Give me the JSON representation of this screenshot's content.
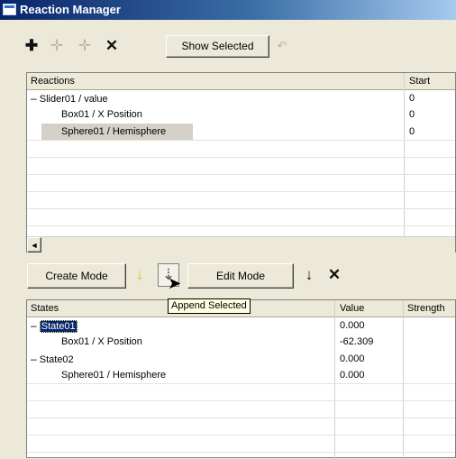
{
  "window": {
    "title": "Reaction Manager"
  },
  "toolbar_top": {
    "icons": [
      "plus-icon",
      "add-slave-icon",
      "add-selected-icon",
      "delete-icon",
      "undo-icon"
    ],
    "show_selected_label": "Show Selected"
  },
  "reactions": {
    "columns": [
      "Reactions",
      "Start"
    ],
    "rows": [
      {
        "expander": "–",
        "name": "Slider01 / value",
        "start": "0"
      },
      {
        "name": "Box01 / X Position",
        "start": "0"
      },
      {
        "name": "Sphere01 / Hemisphere",
        "start": "0",
        "selected": true
      }
    ],
    "scroll_left_glyph": "◄"
  },
  "toolbar_bottom": {
    "create_mode_label": "Create Mode",
    "edit_mode_label": "Edit Mode",
    "tooltip": "Append Selected",
    "icons": [
      "create-state-icon",
      "append-selected-icon",
      "set-state-icon",
      "delete-state-icon"
    ]
  },
  "states": {
    "columns": [
      "States",
      "Value",
      "Strength"
    ],
    "rows": [
      {
        "expander": "–",
        "name": "State01",
        "value": "0.000",
        "selected": true
      },
      {
        "name": "Box01 / X Position",
        "value": "-62.309"
      },
      {
        "expander": "–",
        "name": "State02",
        "value": "0.000"
      },
      {
        "name": "Sphere01 / Hemisphere",
        "value": "0.000"
      }
    ]
  }
}
